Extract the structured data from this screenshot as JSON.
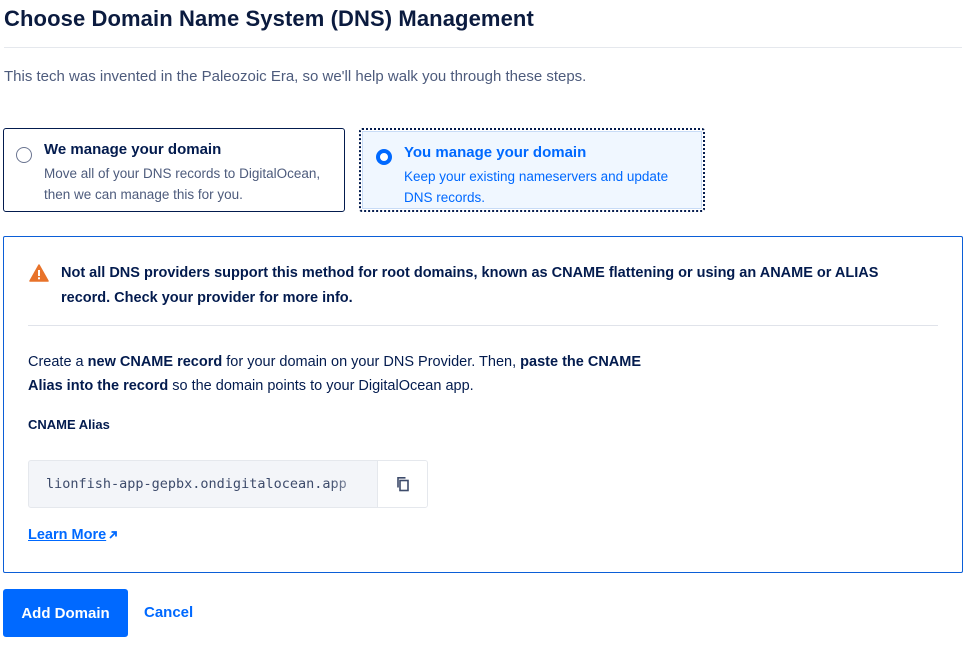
{
  "page": {
    "title": "Choose Domain Name System (DNS) Management",
    "intro": "This tech was invented in the Paleozoic Era, so we'll help walk you through these steps."
  },
  "options": [
    {
      "title": "We manage your domain",
      "description": "Move all of your DNS records to DigitalOcean, then we can manage this for you.",
      "selected": false
    },
    {
      "title": "You manage your domain",
      "description": "Keep your existing nameservers and update DNS records.",
      "selected": true
    }
  ],
  "panel": {
    "warning_icon": "warning-triangle-icon",
    "warning": "Not all DNS providers support this method for root domains, known as CNAME flattening or using an ANAME or ALIAS record. Check your provider for more info.",
    "instructions": {
      "part1": "Create a ",
      "part2": "new CNAME record",
      "part3": " for your domain on your DNS Provider. Then, ",
      "part4": "paste the CNAME Alias into the record",
      "part5": " so the domain points to your DigitalOcean app."
    },
    "alias_label": "CNAME Alias",
    "alias_value": "lionfish-app-gepbx.ondigitalocean.app",
    "copy_icon": "copy-icon",
    "learn_more": "Learn More",
    "learn_more_icon": "external-arrow-icon"
  },
  "actions": {
    "primary": "Add Domain",
    "cancel": "Cancel"
  },
  "colors": {
    "accent": "#0069ff",
    "text": "#031b4e",
    "warning": "#e8732a"
  }
}
